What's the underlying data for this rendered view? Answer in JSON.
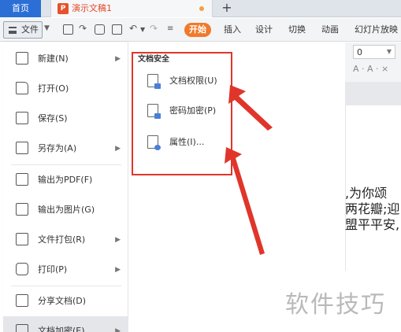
{
  "tabbar": {
    "home_label": "首页",
    "doc_icon_letter": "P",
    "doc_title": "演示文稿1",
    "add_symbol": "+"
  },
  "toolbar": {
    "file_label": "文件",
    "start_label": "开始",
    "menu_tabs": [
      "插入",
      "设计",
      "切换",
      "动画",
      "幻灯片放映"
    ]
  },
  "ribbon": {
    "font_size": "0",
    "symbols": "A · A · ×"
  },
  "file_menu": {
    "items": [
      {
        "label": "新建(N)",
        "icon": "new-file-icon",
        "has_submenu": true
      },
      {
        "label": "打开(O)",
        "icon": "open-folder-icon",
        "has_submenu": false
      },
      {
        "label": "保存(S)",
        "icon": "save-icon",
        "has_submenu": false
      },
      {
        "label": "另存为(A)",
        "icon": "save-as-icon",
        "has_submenu": true
      },
      {
        "label": "输出为PDF(F)",
        "icon": "pdf-export-icon",
        "has_submenu": false
      },
      {
        "label": "输出为图片(G)",
        "icon": "image-export-icon",
        "has_submenu": false
      },
      {
        "label": "文件打包(R)",
        "icon": "package-icon",
        "has_submenu": true
      },
      {
        "label": "打印(P)",
        "icon": "print-icon",
        "has_submenu": true
      },
      {
        "label": "分享文档(D)",
        "icon": "share-icon",
        "has_submenu": false
      },
      {
        "label": "文档加密(E)",
        "icon": "encrypt-icon",
        "has_submenu": true
      }
    ]
  },
  "submenu": {
    "title": "文档安全",
    "items": [
      {
        "label": "文档权限(U)",
        "icon": "document-permission-icon"
      },
      {
        "label": "密码加密(P)",
        "icon": "password-lock-icon"
      },
      {
        "label": "属性(I)...",
        "icon": "properties-icon"
      }
    ]
  },
  "document": {
    "lines": [
      ",为你颂",
      "两花瓣;迎",
      "盟平平安,"
    ]
  },
  "watermark": "软件技巧",
  "colors": {
    "accent_blue": "#2b6fd6",
    "start_orange": "#f07a2a",
    "highlight_red": "#e0352b"
  }
}
